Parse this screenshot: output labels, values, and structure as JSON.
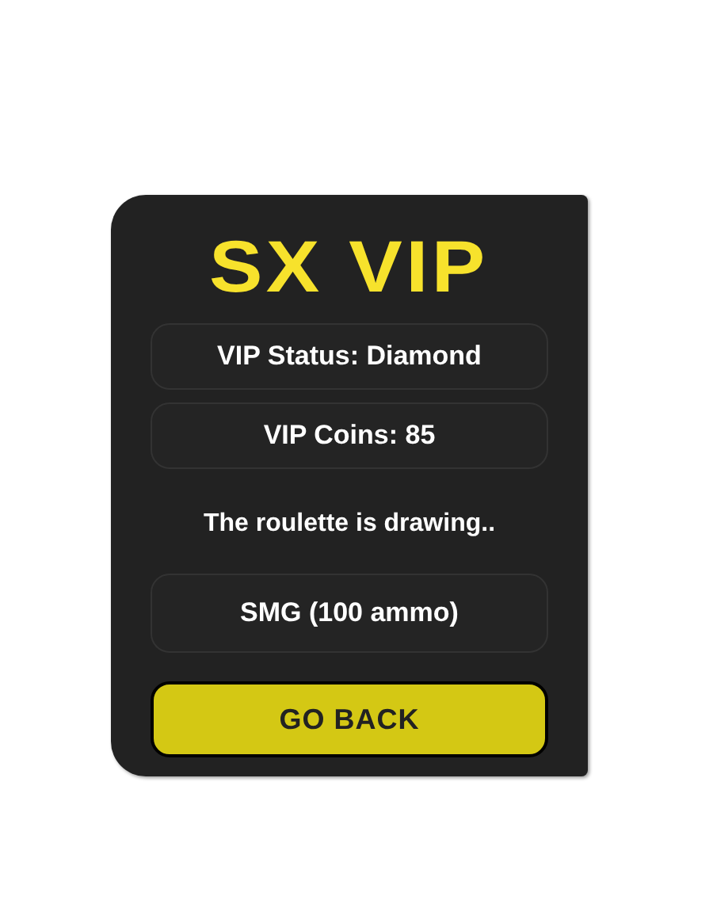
{
  "logo": "SX VIP",
  "info": [
    "VIP Status: Diamond",
    "VIP Coins: 85"
  ],
  "message": "The roulette is drawing..",
  "result": "SMG (100 ammo)",
  "button": "GO BACK"
}
